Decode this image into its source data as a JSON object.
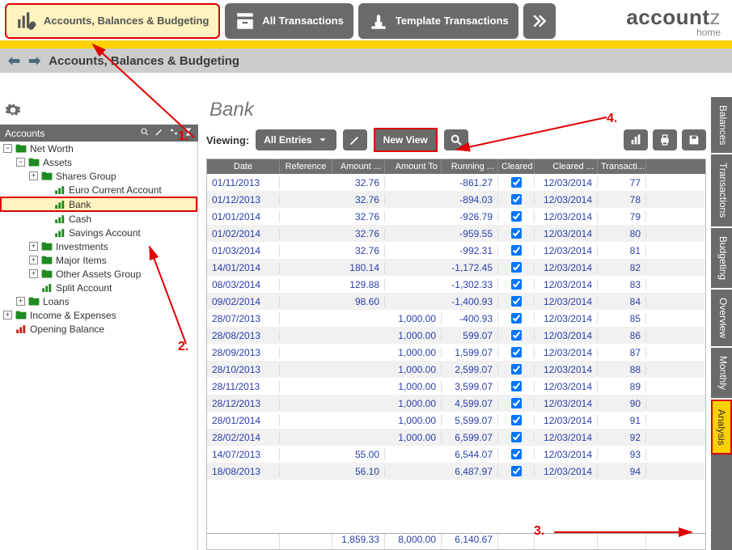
{
  "toolbar": {
    "accounts_btn": "Accounts, Balances\n& Budgeting",
    "all_trans_btn": "All\nTransactions",
    "template_btn": "Template\nTransactions"
  },
  "brand": {
    "name_heavy": "account",
    "name_light": "z",
    "sub": "home"
  },
  "breadcrumb": "Accounts, Balances & Budgeting",
  "sidebar": {
    "title": "Accounts",
    "items": [
      {
        "label": "Net Worth",
        "depth": 0,
        "exp": "-",
        "icon": "folder-green"
      },
      {
        "label": "Assets",
        "depth": 1,
        "exp": "-",
        "icon": "folder-green"
      },
      {
        "label": "Shares Group",
        "depth": 2,
        "exp": "+",
        "icon": "folder-green"
      },
      {
        "label": "Euro Current Account",
        "depth": 3,
        "exp": "",
        "icon": "chart-green"
      },
      {
        "label": "Bank",
        "depth": 3,
        "exp": "",
        "icon": "chart-green",
        "selected": true
      },
      {
        "label": "Cash",
        "depth": 3,
        "exp": "",
        "icon": "chart-green"
      },
      {
        "label": "Savings Account",
        "depth": 3,
        "exp": "",
        "icon": "chart-green"
      },
      {
        "label": "Investments",
        "depth": 2,
        "exp": "+",
        "icon": "folder-green"
      },
      {
        "label": "Major Items",
        "depth": 2,
        "exp": "+",
        "icon": "folder-green"
      },
      {
        "label": "Other Assets Group",
        "depth": 2,
        "exp": "+",
        "icon": "folder-green"
      },
      {
        "label": "Split Account",
        "depth": 2,
        "exp": "",
        "icon": "chart-green"
      },
      {
        "label": "Loans",
        "depth": 1,
        "exp": "+",
        "icon": "folder-green"
      },
      {
        "label": "Income & Expenses",
        "depth": 0,
        "exp": "+",
        "icon": "folder-green"
      },
      {
        "label": "Opening Balance",
        "depth": 0,
        "exp": "",
        "icon": "chart-red"
      }
    ]
  },
  "main": {
    "title": "Bank",
    "viewing_label": "Viewing:",
    "dropdown": "All Entries",
    "new_view_btn": "New View",
    "columns": [
      "Date",
      "Reference",
      "Amount ...",
      "Amount To",
      "Running ...",
      "Cleared",
      "Cleared ...",
      "Transacti..."
    ],
    "rows": [
      {
        "date": "01/11/2013",
        "ref": "",
        "af": "32.76",
        "at": "",
        "run": "-861.27",
        "clr": true,
        "cld": "12/03/2014",
        "trn": "77"
      },
      {
        "date": "01/12/2013",
        "ref": "",
        "af": "32.76",
        "at": "",
        "run": "-894.03",
        "clr": true,
        "cld": "12/03/2014",
        "trn": "78"
      },
      {
        "date": "01/01/2014",
        "ref": "",
        "af": "32.76",
        "at": "",
        "run": "-926.79",
        "clr": true,
        "cld": "12/03/2014",
        "trn": "79"
      },
      {
        "date": "01/02/2014",
        "ref": "",
        "af": "32.76",
        "at": "",
        "run": "-959.55",
        "clr": true,
        "cld": "12/03/2014",
        "trn": "80"
      },
      {
        "date": "01/03/2014",
        "ref": "",
        "af": "32.76",
        "at": "",
        "run": "-992.31",
        "clr": true,
        "cld": "12/03/2014",
        "trn": "81"
      },
      {
        "date": "14/01/2014",
        "ref": "",
        "af": "180.14",
        "at": "",
        "run": "-1,172.45",
        "clr": true,
        "cld": "12/03/2014",
        "trn": "82"
      },
      {
        "date": "08/03/2014",
        "ref": "",
        "af": "129.88",
        "at": "",
        "run": "-1,302.33",
        "clr": true,
        "cld": "12/03/2014",
        "trn": "83"
      },
      {
        "date": "09/02/2014",
        "ref": "",
        "af": "98.60",
        "at": "",
        "run": "-1,400.93",
        "clr": true,
        "cld": "12/03/2014",
        "trn": "84"
      },
      {
        "date": "28/07/2013",
        "ref": "",
        "af": "",
        "at": "1,000.00",
        "run": "-400.93",
        "clr": true,
        "cld": "12/03/2014",
        "trn": "85"
      },
      {
        "date": "28/08/2013",
        "ref": "",
        "af": "",
        "at": "1,000.00",
        "run": "599.07",
        "clr": true,
        "cld": "12/03/2014",
        "trn": "86"
      },
      {
        "date": "28/09/2013",
        "ref": "",
        "af": "",
        "at": "1,000.00",
        "run": "1,599.07",
        "clr": true,
        "cld": "12/03/2014",
        "trn": "87"
      },
      {
        "date": "28/10/2013",
        "ref": "",
        "af": "",
        "at": "1,000.00",
        "run": "2,599.07",
        "clr": true,
        "cld": "12/03/2014",
        "trn": "88"
      },
      {
        "date": "28/11/2013",
        "ref": "",
        "af": "",
        "at": "1,000.00",
        "run": "3,599.07",
        "clr": true,
        "cld": "12/03/2014",
        "trn": "89"
      },
      {
        "date": "28/12/2013",
        "ref": "",
        "af": "",
        "at": "1,000.00",
        "run": "4,599.07",
        "clr": true,
        "cld": "12/03/2014",
        "trn": "90"
      },
      {
        "date": "28/01/2014",
        "ref": "",
        "af": "",
        "at": "1,000.00",
        "run": "5,599.07",
        "clr": true,
        "cld": "12/03/2014",
        "trn": "91"
      },
      {
        "date": "28/02/2014",
        "ref": "",
        "af": "",
        "at": "1,000.00",
        "run": "6,599.07",
        "clr": true,
        "cld": "12/03/2014",
        "trn": "92"
      },
      {
        "date": "14/07/2013",
        "ref": "",
        "af": "55.00",
        "at": "",
        "run": "6,544.07",
        "clr": true,
        "cld": "12/03/2014",
        "trn": "93"
      },
      {
        "date": "18/08/2013",
        "ref": "",
        "af": "56.10",
        "at": "",
        "run": "6,487.97",
        "clr": true,
        "cld": "12/03/2014",
        "trn": "94"
      }
    ],
    "totals": {
      "af": "1,859.33",
      "at": "8,000.00",
      "run": "6,140.67"
    }
  },
  "side_tabs": [
    "Balances",
    "Transactions",
    "Budgeting",
    "Overview",
    "Monthly",
    "Analysis"
  ],
  "annotations": {
    "n1": "1.",
    "n2": "2.",
    "n3": "3.",
    "n4": "4."
  }
}
